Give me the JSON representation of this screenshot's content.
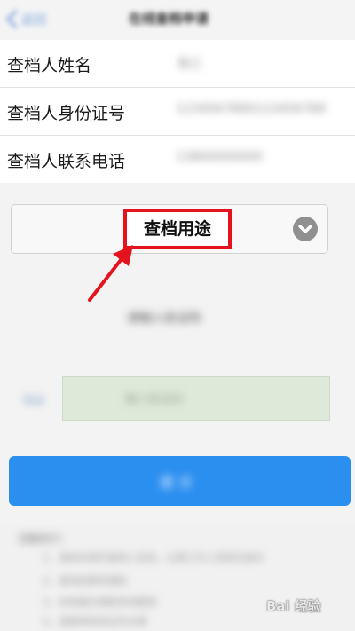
{
  "nav": {
    "back_label": "返回",
    "title": "在线查档申请"
  },
  "form": {
    "rows": [
      {
        "label": "查档人姓名",
        "value": "张三"
      },
      {
        "label": "查档人身份证号",
        "value": "1234567890123456789"
      },
      {
        "label": "查档人联系电话",
        "value": "13800000000"
      }
    ]
  },
  "purpose_select": {
    "label": "查档用途",
    "icon": "chevron-down-icon"
  },
  "highlight_color": "#e4141e",
  "section": {
    "subheading": "请输入验证码"
  },
  "verify": {
    "label": "验证",
    "placeholder": "输入验证码"
  },
  "submit": {
    "label": "提 交"
  },
  "notice": {
    "title": "温馨提示：",
    "lines": [
      "1、请如实填写查档人信息，以便工作人员核实身份",
      "2、查档结果将通知",
      "3、如有疑问请联系档案馆",
      "4、请携带有效证件办理"
    ]
  },
  "watermark": "Bai 经验"
}
